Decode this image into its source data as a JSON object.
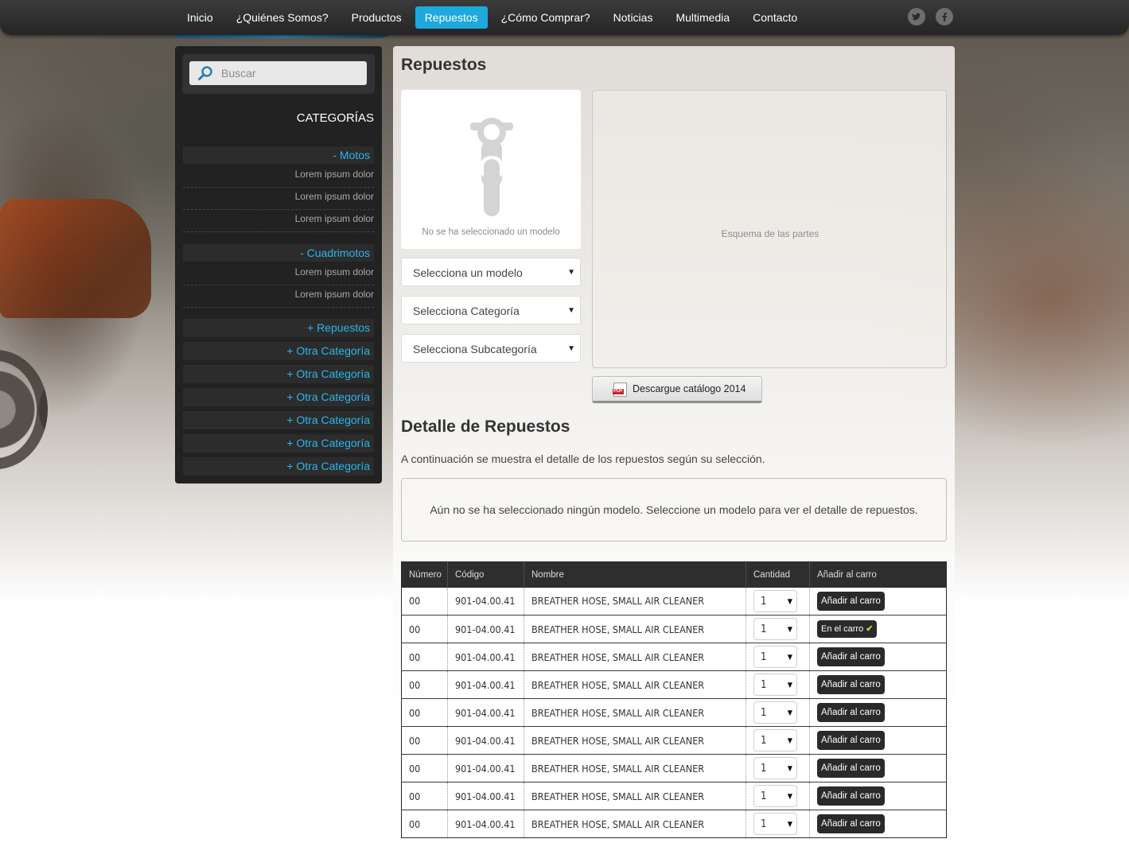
{
  "nav": {
    "items": [
      {
        "label": "Inicio",
        "active": false
      },
      {
        "label": "¿Quiénes Somos?",
        "active": false
      },
      {
        "label": "Productos",
        "active": false
      },
      {
        "label": "Repuestos",
        "active": true
      },
      {
        "label": "¿Cómo Comprar?",
        "active": false
      },
      {
        "label": "Noticias",
        "active": false
      },
      {
        "label": "Multimedia",
        "active": false
      },
      {
        "label": "Contacto",
        "active": false
      }
    ],
    "social": {
      "twitter_icon": "twitter-icon",
      "facebook_icon": "facebook-icon"
    }
  },
  "sidebar": {
    "search_placeholder": "Buscar",
    "categories_title": "CATEGORÍAS",
    "groups": [
      {
        "label": "- Motos",
        "subitems": [
          "Lorem ipsum dolor",
          "Lorem ipsum dolor",
          "Lorem ipsum dolor"
        ]
      },
      {
        "label": "- Cuadrimotos",
        "subitems": [
          "Lorem ipsum dolor",
          "Lorem ipsum dolor"
        ]
      }
    ],
    "collapsed": [
      "+ Repuestos",
      "+ Otra Categoría",
      "+ Otra Categoría",
      "+ Otra Categoría",
      "+ Otra Categoría",
      "+ Otra Categoría",
      "+ Otra Categoría"
    ]
  },
  "main": {
    "title": "Repuestos",
    "model_placeholder_text": "No se ha seleccionado un modelo",
    "selects": [
      "Selecciona un modelo",
      "Selecciona Categoría",
      "Selecciona Subcategoría"
    ],
    "scheme_label": "Esquema de las partes",
    "download_label": "Descargue catálogo 2014",
    "pdf_badge": "PDF",
    "detail_title": "Detalle de Repuestos",
    "detail_desc": "A continuación se muestra el detalle de los repuestos según su selección.",
    "notice": "Aún no se ha seleccionado ningún modelo. Seleccione un modelo para ver el detalle de repuestos."
  },
  "table": {
    "headers": [
      "Número",
      "Código",
      "Nombre",
      "Cantidad",
      "Añadir al carro"
    ],
    "rows": [
      {
        "numero": "00",
        "codigo": "901-04.00.41",
        "nombre": "BREATHER HOSE, SMALL AIR CLEANER",
        "cantidad": "1",
        "action": "Añadir al carro",
        "in_cart": false
      },
      {
        "numero": "00",
        "codigo": "901-04.00.41",
        "nombre": "BREATHER HOSE, SMALL AIR CLEANER",
        "cantidad": "1",
        "action": "En el carro",
        "in_cart": true
      },
      {
        "numero": "00",
        "codigo": "901-04.00.41",
        "nombre": "BREATHER HOSE, SMALL AIR CLEANER",
        "cantidad": "1",
        "action": "Añadir al carro",
        "in_cart": false
      },
      {
        "numero": "00",
        "codigo": "901-04.00.41",
        "nombre": "BREATHER HOSE, SMALL AIR CLEANER",
        "cantidad": "1",
        "action": "Añadir al carro",
        "in_cart": false
      },
      {
        "numero": "00",
        "codigo": "901-04.00.41",
        "nombre": "BREATHER HOSE, SMALL AIR CLEANER",
        "cantidad": "1",
        "action": "Añadir al carro",
        "in_cart": false
      },
      {
        "numero": "00",
        "codigo": "901-04.00.41",
        "nombre": "BREATHER HOSE, SMALL AIR CLEANER",
        "cantidad": "1",
        "action": "Añadir al carro",
        "in_cart": false
      },
      {
        "numero": "00",
        "codigo": "901-04.00.41",
        "nombre": "BREATHER HOSE, SMALL AIR CLEANER",
        "cantidad": "1",
        "action": "Añadir al carro",
        "in_cart": false
      },
      {
        "numero": "00",
        "codigo": "901-04.00.41",
        "nombre": "BREATHER HOSE, SMALL AIR CLEANER",
        "cantidad": "1",
        "action": "Añadir al carro",
        "in_cart": false
      },
      {
        "numero": "00",
        "codigo": "901-04.00.41",
        "nombre": "BREATHER HOSE, SMALL AIR CLEANER",
        "cantidad": "1",
        "action": "Añadir al carro",
        "in_cart": false
      }
    ]
  },
  "colors": {
    "accent": "#1ea9dc",
    "link": "#29b6ec",
    "dark": "#222222"
  }
}
